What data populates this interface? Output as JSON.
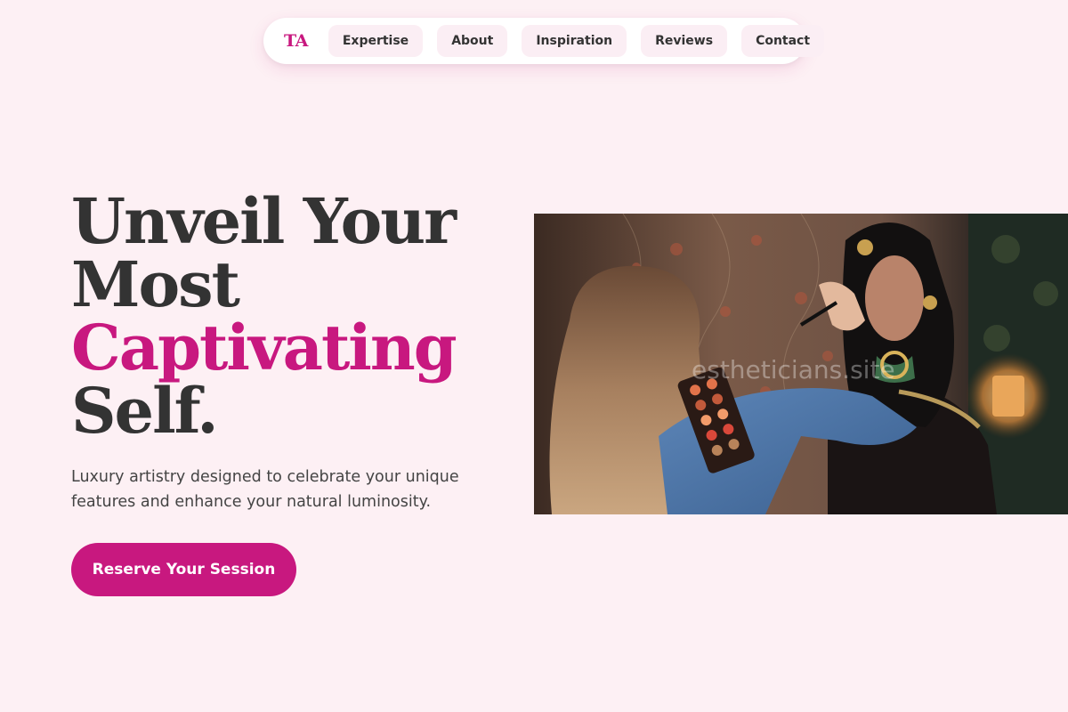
{
  "nav": {
    "logo": "TA",
    "items": [
      {
        "label": "Expertise"
      },
      {
        "label": "About"
      },
      {
        "label": "Inspiration"
      },
      {
        "label": "Reviews"
      },
      {
        "label": "Contact"
      }
    ]
  },
  "hero": {
    "headline": {
      "line1": "Unveil Your",
      "line2": "Most",
      "line3_accent": "Captivating",
      "line4": "Self."
    },
    "subtitle": "Luxury artistry designed to celebrate your unique features and enhance your natural luminosity.",
    "cta_label": "Reserve Your Session",
    "image": {
      "watermark": "estheticians.site"
    }
  },
  "colors": {
    "accent": "#c8187f",
    "background": "#fdf0f4",
    "text": "#333333",
    "nav_item_bg": "#fbeef4"
  }
}
